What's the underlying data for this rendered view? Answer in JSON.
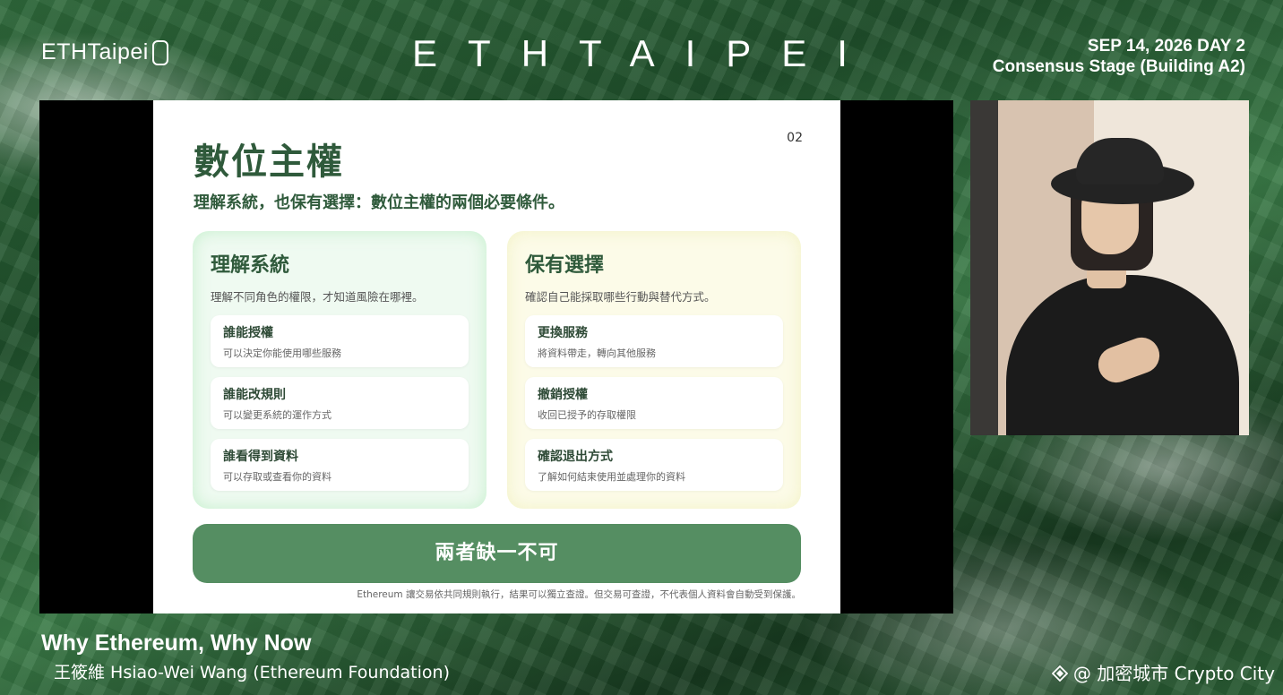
{
  "header": {
    "brand_left": "ETHTaipei",
    "wordmark": "ETHTAIPEI",
    "event_date": "SEP 14, 2026 DAY 2",
    "event_stage": "Consensus Stage (Building A2)"
  },
  "slide": {
    "title": "數位主權",
    "page_number": "02",
    "subtitle": "理解系統，也保有選擇：數位主權的兩個必要條件。",
    "panels": [
      {
        "title": "理解系統",
        "desc": "理解不同角色的權限，才知道風險在哪裡。",
        "cards": [
          {
            "title": "誰能授權",
            "desc": "可以決定你能使用哪些服務"
          },
          {
            "title": "誰能改規則",
            "desc": "可以變更系統的運作方式"
          },
          {
            "title": "誰看得到資料",
            "desc": "可以存取或查看你的資料"
          }
        ]
      },
      {
        "title": "保有選擇",
        "desc": "確認自己能採取哪些行動與替代方式。",
        "cards": [
          {
            "title": "更換服務",
            "desc": "將資料帶走，轉向其他服務"
          },
          {
            "title": "撤銷授權",
            "desc": "收回已授予的存取權限"
          },
          {
            "title": "確認退出方式",
            "desc": "了解如何結束使用並處理你的資料"
          }
        ]
      }
    ],
    "banner": "兩者缺一不可",
    "footnote": "Ethereum 讓交易依共同規則執行，結果可以獨立查證。但交易可查證，不代表個人資料會自動受到保護。"
  },
  "lower_third": {
    "talk_title": "Why Ethereum, Why Now",
    "speaker": "王筱維 Hsiao-Wei Wang (Ethereum Foundation)"
  },
  "credit": {
    "text": "@ 加密城市 Crypto City"
  },
  "colors": {
    "accent_green": "#2f5a3b",
    "banner_green": "#558e62",
    "panel_left_bg": "#effaf1",
    "panel_right_bg": "#fcfbe8"
  }
}
